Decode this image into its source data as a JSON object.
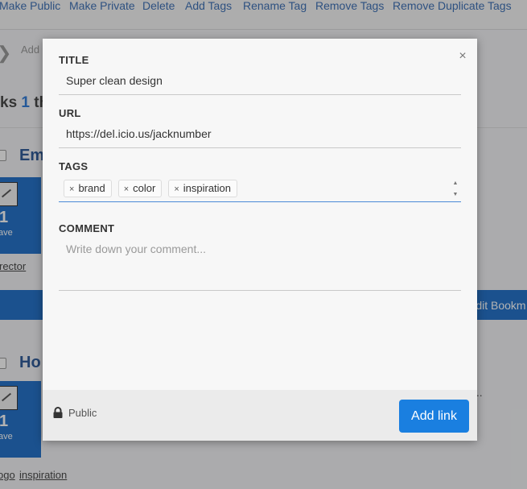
{
  "toolbar": {
    "items": [
      "Make Public",
      "Make Private",
      "Delete",
      "Add Tags",
      "Rename Tag",
      "Remove Tags",
      "Remove Duplicate Tags"
    ]
  },
  "background": {
    "row2_text": "Add",
    "links_prefix": "ks",
    "links_count": "1",
    "links_suffix": "th",
    "items": [
      {
        "title": "Em",
        "count": "1",
        "count_label": "ave",
        "tag_link": "rector"
      },
      {
        "title": "Ho",
        "count": "1",
        "count_label": "ave",
        "tag_links": [
          "ogo",
          "inspiration"
        ]
      }
    ],
    "edit_label": "Edit Bookm",
    "ellipsis": "..."
  },
  "modal": {
    "close_glyph": "×",
    "title_label": "TITLE",
    "title_value": "Super clean design",
    "url_label": "URL",
    "url_value": "https://del.icio.us/jacknumber",
    "tags_label": "TAGS",
    "tags": [
      "brand",
      "color",
      "inspiration"
    ],
    "tag_remove_glyph": "×",
    "spinner_up": "▲",
    "spinner_down": "▼",
    "comment_label": "COMMENT",
    "comment_placeholder": "Write down your comment...",
    "visibility": "Public",
    "lock_icon": "lock-icon",
    "add_button": "Add link",
    "accent_color": "#1a7fe0"
  }
}
